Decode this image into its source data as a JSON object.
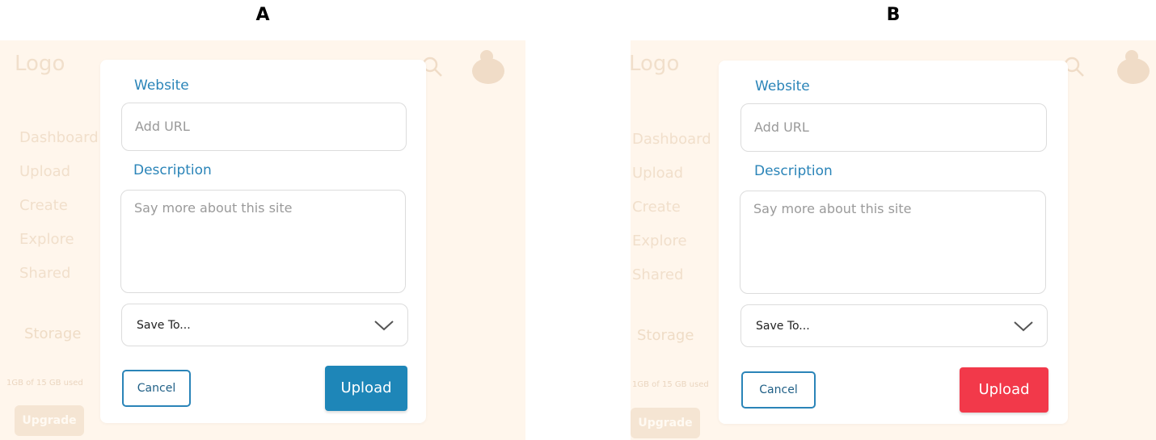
{
  "variants": [
    {
      "label": "A",
      "background": {
        "logo": "Logo",
        "nav": [
          "Dashboard",
          "Upload",
          "Create",
          "Explore",
          "Shared"
        ],
        "storage": "Storage",
        "usage": "1GB of 15 GB used",
        "upgrade": "Upgrade"
      },
      "dialog": {
        "website_label": "Website",
        "url_placeholder": "Add URL",
        "description_label": "Description",
        "description_placeholder": "Say more about this site",
        "save_to": "Save To...",
        "cancel": "Cancel",
        "upload": "Upload",
        "upload_color": "#1e86b8"
      }
    },
    {
      "label": "B",
      "background": {
        "logo": "Logo",
        "nav": [
          "Dashboard",
          "Upload",
          "Create",
          "Explore",
          "Shared"
        ],
        "storage": "Storage",
        "usage": "1GB of 15 GB used",
        "upgrade": "Upgrade"
      },
      "dialog": {
        "website_label": "Website",
        "url_placeholder": "Add URL",
        "description_label": "Description",
        "description_placeholder": "Say more about this site",
        "save_to": "Save To...",
        "cancel": "Cancel",
        "upload": "Upload",
        "upload_color": "#f2394a"
      }
    }
  ]
}
